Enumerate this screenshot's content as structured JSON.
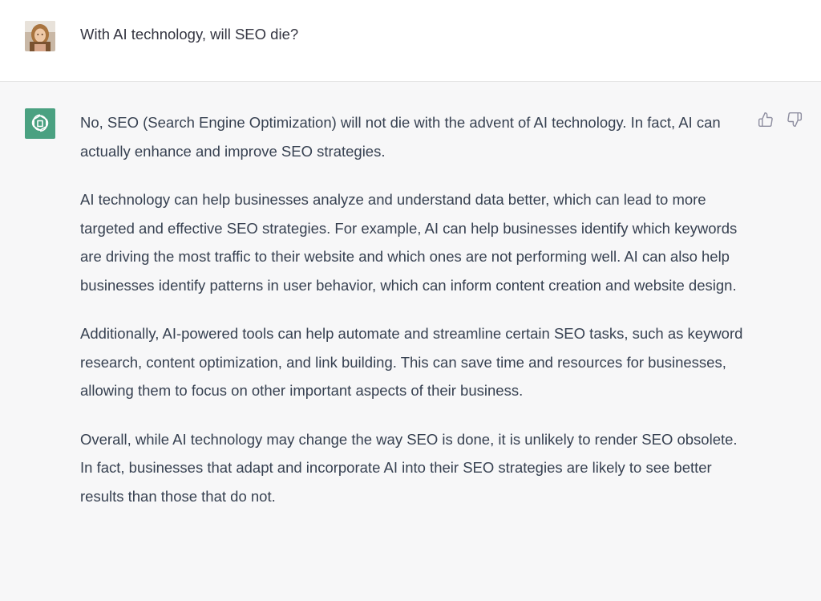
{
  "conversation": {
    "user_message": "With AI technology, will SEO die?",
    "assistant_paragraphs": [
      "No, SEO (Search Engine Optimization) will not die with the advent of AI technology. In fact, AI can actually enhance and improve SEO strategies.",
      "AI technology can help businesses analyze and understand data better, which can lead to more targeted and effective SEO strategies. For example, AI can help businesses identify which keywords are driving the most traffic to their website and which ones are not performing well. AI can also help businesses identify patterns in user behavior, which can inform content creation and website design.",
      "Additionally, AI-powered tools can help automate and streamline certain SEO tasks, such as keyword research, content optimization, and link building. This can save time and resources for businesses, allowing them to focus on other important aspects of their business.",
      "Overall, while AI technology may change the way SEO is done, it is unlikely to render SEO obsolete. In fact, businesses that adapt and incorporate AI into their SEO strategies are likely to see better results than those that do not."
    ]
  },
  "icons": {
    "user_avatar": "user-avatar-photo",
    "assistant_logo": "openai-logo-icon",
    "thumbs_up": "thumbs-up-icon",
    "thumbs_down": "thumbs-down-icon"
  },
  "colors": {
    "assistant_logo_bg": "#4aa181",
    "assistant_bg": "#f7f7f8",
    "user_bg": "#ffffff",
    "text": "#374151"
  }
}
